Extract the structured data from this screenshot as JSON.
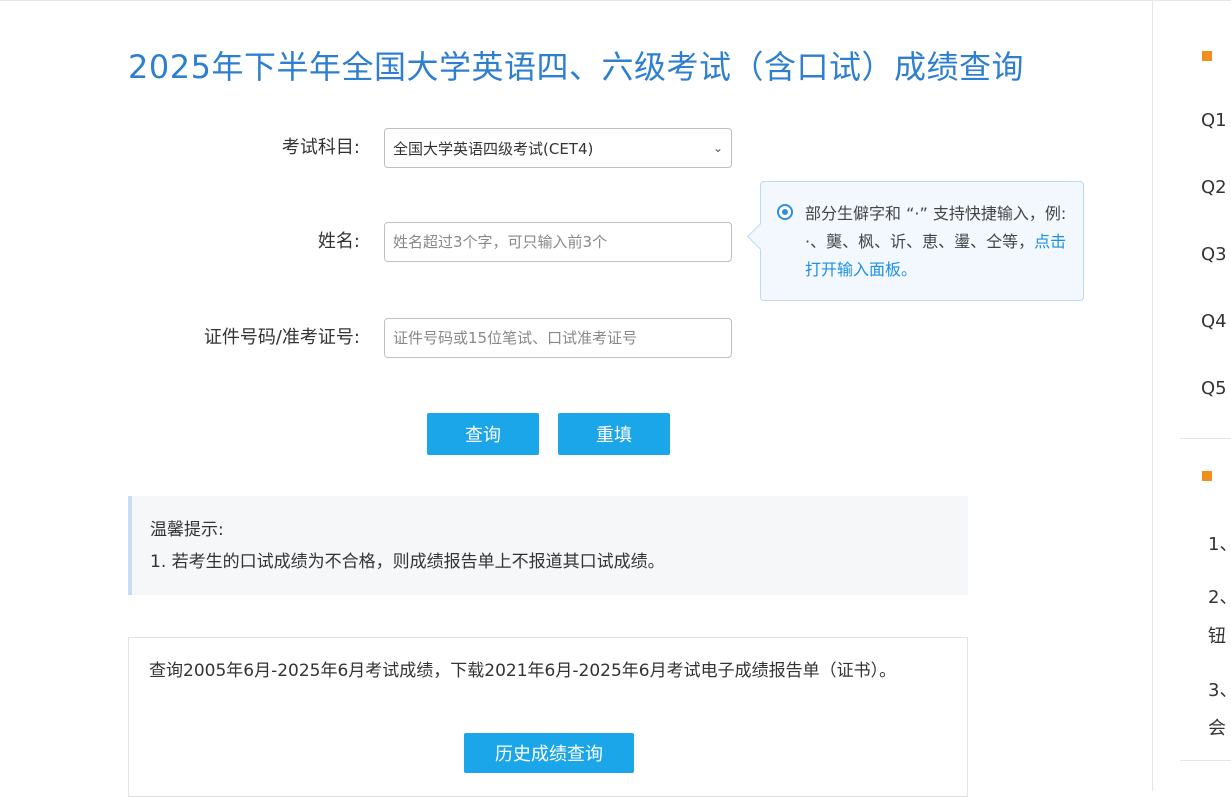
{
  "page_title": "2025年下半年全国大学英语四、六级考试（含口试）成绩查询",
  "form": {
    "subject_label": "考试科目:",
    "subject_selected": "全国大学英语四级考试(CET4)",
    "name_label": "姓名:",
    "name_placeholder": "姓名超过3个字，可只输入前3个",
    "id_label": "证件号码/准考证号:",
    "id_placeholder": "证件号码或15位笔试、口试准考证号"
  },
  "tip": {
    "text": "部分生僻字和 “·” 支持快捷输入，例: ·、龑、枫、䜣、恵、璗、仝等，",
    "link": "点击打开输入面板。"
  },
  "buttons": {
    "query": "查询",
    "reset": "重填"
  },
  "notice": {
    "title": "温馨提示:",
    "line1": "1. 若考生的口试成绩为不合格，则成绩报告单上不报道其口试成绩。"
  },
  "history": {
    "text": "查询2005年6月-2025年6月考试成绩，下载2021年6月-2025年6月考试电子成绩报告单（证书）。",
    "button": "历史成绩查询"
  },
  "right_panel": {
    "faq": [
      "Q1",
      "Q2",
      "Q3",
      "Q4",
      "Q5"
    ],
    "notes": [
      "1、",
      "2、",
      "钮",
      "3、",
      "会"
    ]
  },
  "colors": {
    "title_blue": "#2f7fd0",
    "button_blue": "#1ba6ea",
    "link_blue": "#1e8fe6",
    "accent_orange": "#f08f1c"
  }
}
